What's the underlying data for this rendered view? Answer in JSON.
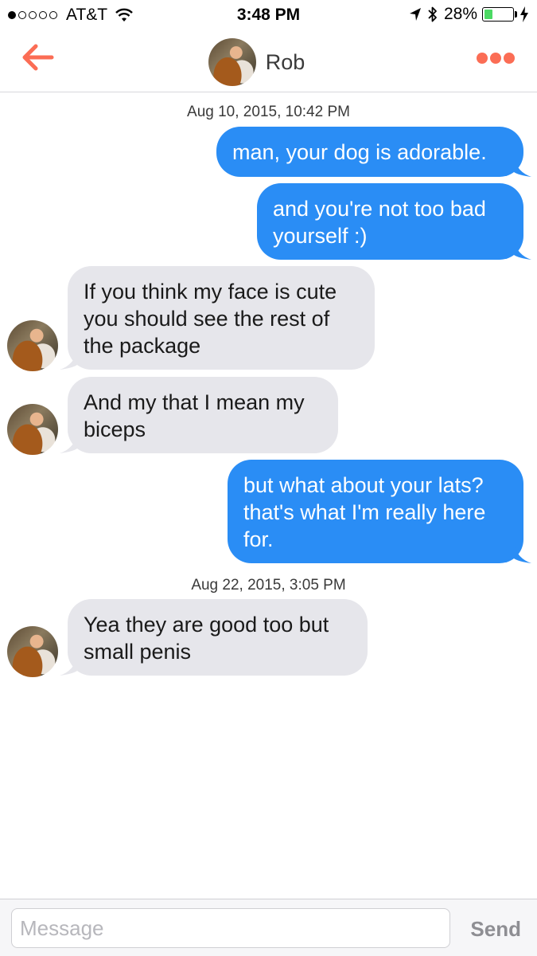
{
  "status_bar": {
    "carrier": "AT&T",
    "time": "3:48 PM",
    "battery": "28%",
    "battery_level": 0.28,
    "signal_bars": 1,
    "battery_color": "#4cd964"
  },
  "header": {
    "contact_name": "Rob",
    "accent_color": "#fb6d55"
  },
  "conversation": {
    "timestamp_1": "Aug 10, 2015, 10:42 PM",
    "timestamp_2": "Aug 22, 2015, 3:05 PM",
    "messages": [
      {
        "from": "me",
        "text": "man, your dog is adorable."
      },
      {
        "from": "me",
        "text": "and you're not too bad yourself :)"
      },
      {
        "from": "them",
        "text": "If you think my face is cute you should see the rest of the package"
      },
      {
        "from": "them",
        "text": "And my that I mean my biceps"
      },
      {
        "from": "me",
        "text": "but what about your lats? that's what I'm really here for."
      },
      {
        "from": "them",
        "text": "Yea they are good too but small penis"
      }
    ],
    "outgoing_color": "#2a8df5",
    "incoming_color": "#e6e6eb"
  },
  "composer": {
    "placeholder": "Message",
    "send_label": "Send"
  }
}
